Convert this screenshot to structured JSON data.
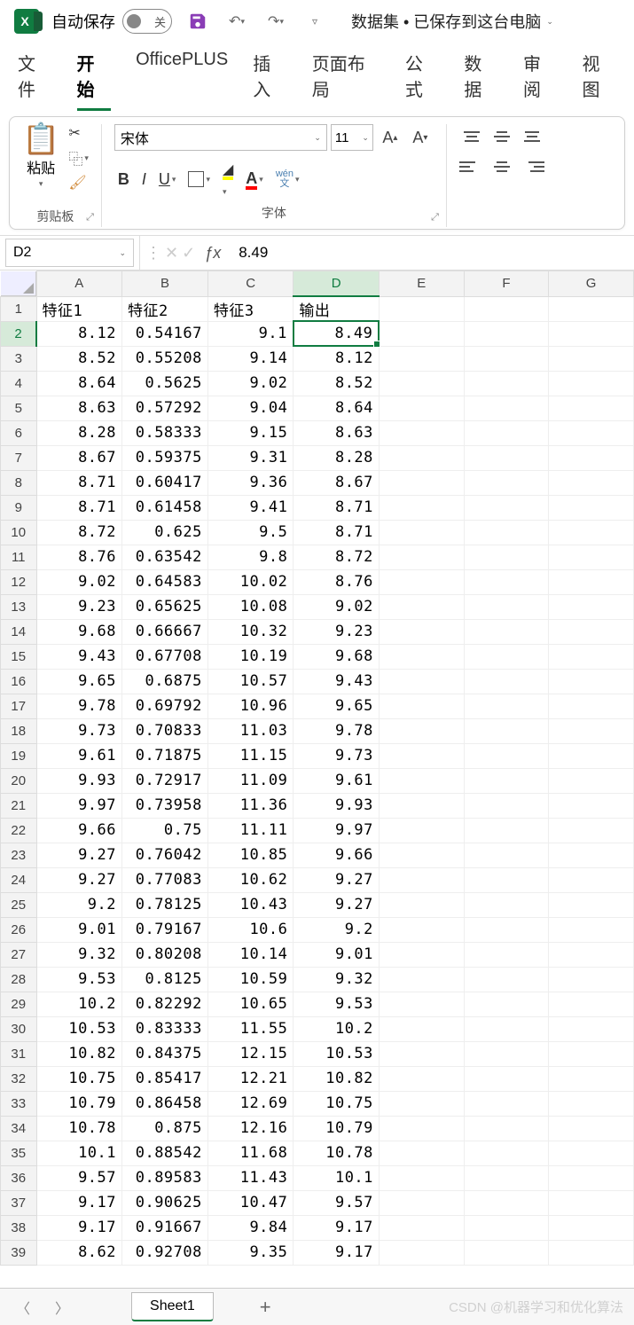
{
  "title": {
    "autosave_label": "自动保存",
    "autosave_state": "关",
    "doc_name": "数据集 • 已保存到这台电脑"
  },
  "tabs": [
    "文件",
    "开始",
    "OfficePLUS",
    "插入",
    "页面布局",
    "公式",
    "数据",
    "审阅",
    "视图"
  ],
  "active_tab": "开始",
  "ribbon": {
    "clipboard_label": "剪贴板",
    "paste_label": "粘贴",
    "font_label": "字体",
    "font_name": "宋体",
    "font_size": "11",
    "wen_top": "wén",
    "wen_bottom": "文"
  },
  "namebox": "D2",
  "formula": "8.49",
  "columns": [
    "A",
    "B",
    "C",
    "D",
    "E",
    "F",
    "G"
  ],
  "active_col": "D",
  "active_row": 2,
  "headers": [
    "特征1",
    "特征2",
    "特征3",
    "输出"
  ],
  "rows": [
    [
      "8.12",
      "0.54167",
      "9.1",
      "8.49"
    ],
    [
      "8.52",
      "0.55208",
      "9.14",
      "8.12"
    ],
    [
      "8.64",
      "0.5625",
      "9.02",
      "8.52"
    ],
    [
      "8.63",
      "0.57292",
      "9.04",
      "8.64"
    ],
    [
      "8.28",
      "0.58333",
      "9.15",
      "8.63"
    ],
    [
      "8.67",
      "0.59375",
      "9.31",
      "8.28"
    ],
    [
      "8.71",
      "0.60417",
      "9.36",
      "8.67"
    ],
    [
      "8.71",
      "0.61458",
      "9.41",
      "8.71"
    ],
    [
      "8.72",
      "0.625",
      "9.5",
      "8.71"
    ],
    [
      "8.76",
      "0.63542",
      "9.8",
      "8.72"
    ],
    [
      "9.02",
      "0.64583",
      "10.02",
      "8.76"
    ],
    [
      "9.23",
      "0.65625",
      "10.08",
      "9.02"
    ],
    [
      "9.68",
      "0.66667",
      "10.32",
      "9.23"
    ],
    [
      "9.43",
      "0.67708",
      "10.19",
      "9.68"
    ],
    [
      "9.65",
      "0.6875",
      "10.57",
      "9.43"
    ],
    [
      "9.78",
      "0.69792",
      "10.96",
      "9.65"
    ],
    [
      "9.73",
      "0.70833",
      "11.03",
      "9.78"
    ],
    [
      "9.61",
      "0.71875",
      "11.15",
      "9.73"
    ],
    [
      "9.93",
      "0.72917",
      "11.09",
      "9.61"
    ],
    [
      "9.97",
      "0.73958",
      "11.36",
      "9.93"
    ],
    [
      "9.66",
      "0.75",
      "11.11",
      "9.97"
    ],
    [
      "9.27",
      "0.76042",
      "10.85",
      "9.66"
    ],
    [
      "9.27",
      "0.77083",
      "10.62",
      "9.27"
    ],
    [
      "9.2",
      "0.78125",
      "10.43",
      "9.27"
    ],
    [
      "9.01",
      "0.79167",
      "10.6",
      "9.2"
    ],
    [
      "9.32",
      "0.80208",
      "10.14",
      "9.01"
    ],
    [
      "9.53",
      "0.8125",
      "10.59",
      "9.32"
    ],
    [
      "10.2",
      "0.82292",
      "10.65",
      "9.53"
    ],
    [
      "10.53",
      "0.83333",
      "11.55",
      "10.2"
    ],
    [
      "10.82",
      "0.84375",
      "12.15",
      "10.53"
    ],
    [
      "10.75",
      "0.85417",
      "12.21",
      "10.82"
    ],
    [
      "10.79",
      "0.86458",
      "12.69",
      "10.75"
    ],
    [
      "10.78",
      "0.875",
      "12.16",
      "10.79"
    ],
    [
      "10.1",
      "0.88542",
      "11.68",
      "10.78"
    ],
    [
      "9.57",
      "0.89583",
      "11.43",
      "10.1"
    ],
    [
      "9.17",
      "0.90625",
      "10.47",
      "9.57"
    ],
    [
      "9.17",
      "0.91667",
      "9.84",
      "9.17"
    ],
    [
      "8.62",
      "0.92708",
      "9.35",
      "9.17"
    ]
  ],
  "sheet_tab": "Sheet1",
  "watermark": "CSDN @机器学习和优化算法"
}
